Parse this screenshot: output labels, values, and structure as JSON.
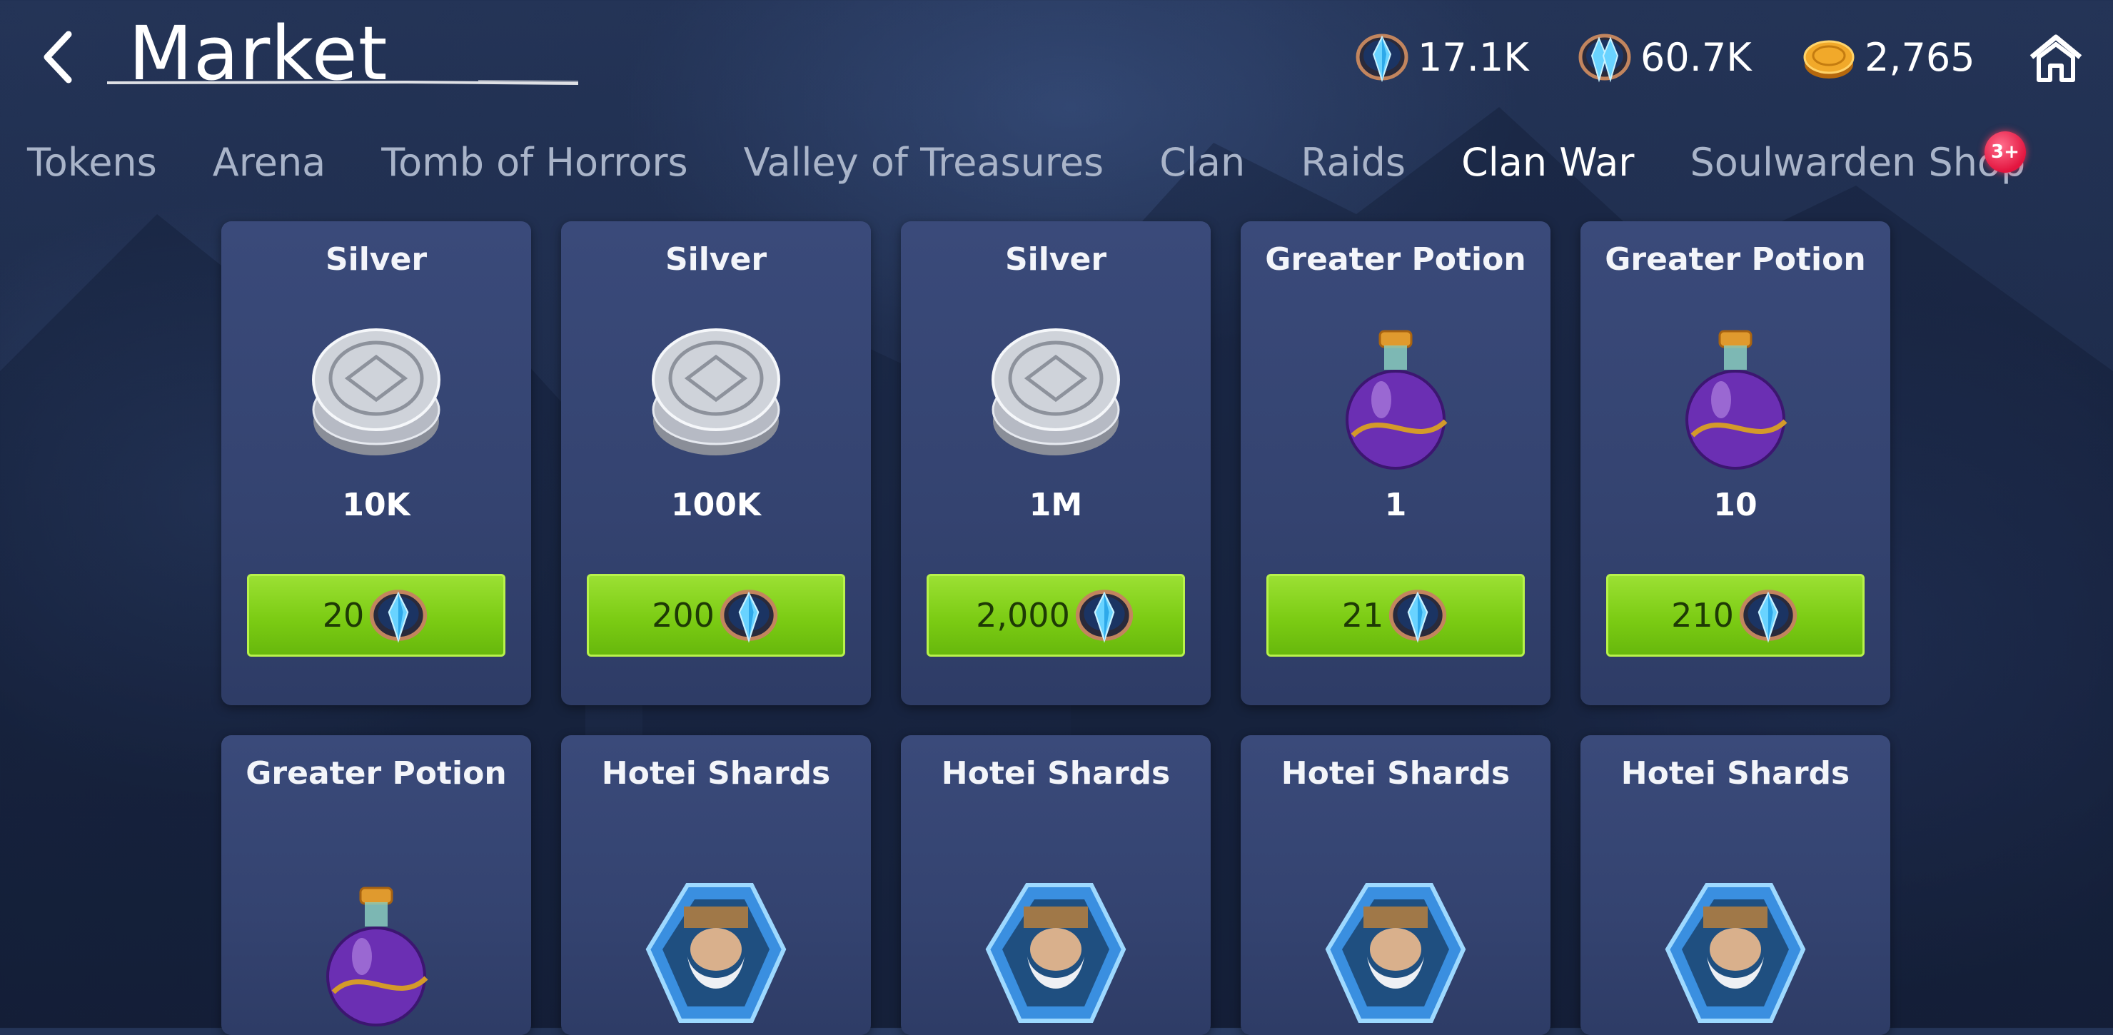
{
  "header": {
    "title": "Market"
  },
  "resources": [
    {
      "icon": "gem-ring-icon",
      "value": "17.1K"
    },
    {
      "icon": "gem-double-icon",
      "value": "60.7K"
    },
    {
      "icon": "gold-coin-icon",
      "value": "2,765"
    }
  ],
  "tabs": [
    {
      "label": "Tokens"
    },
    {
      "label": "Arena"
    },
    {
      "label": "Tomb of Horrors"
    },
    {
      "label": "Valley of Treasures"
    },
    {
      "label": "Clan"
    },
    {
      "label": "Raids"
    },
    {
      "label": "Clan War",
      "active": true
    },
    {
      "label": "Soulwarden Shop"
    }
  ],
  "tab_badge": "3+",
  "items": [
    {
      "title": "Silver",
      "icon": "silver-coins-icon",
      "quantity": "10K",
      "price": "20"
    },
    {
      "title": "Silver",
      "icon": "silver-coins-icon",
      "quantity": "100K",
      "price": "200"
    },
    {
      "title": "Silver",
      "icon": "silver-coins-icon",
      "quantity": "1M",
      "price": "2,000"
    },
    {
      "title": "Greater Potion",
      "icon": "purple-potion-icon",
      "quantity": "1",
      "price": "21"
    },
    {
      "title": "Greater Potion",
      "icon": "purple-potion-icon",
      "quantity": "10",
      "price": "210"
    },
    {
      "title": "Greater Potion",
      "icon": "purple-potion-icon"
    },
    {
      "title": "Hotei Shards",
      "icon": "hotei-shard-icon"
    },
    {
      "title": "Hotei Shards",
      "icon": "hotei-shard-icon"
    },
    {
      "title": "Hotei Shards",
      "icon": "hotei-shard-icon"
    },
    {
      "title": "Hotei Shards",
      "icon": "hotei-shard-icon"
    }
  ],
  "colors": {
    "price_button": "#7ccc14",
    "card_bg": "#344370",
    "badge": "#e3153f"
  }
}
